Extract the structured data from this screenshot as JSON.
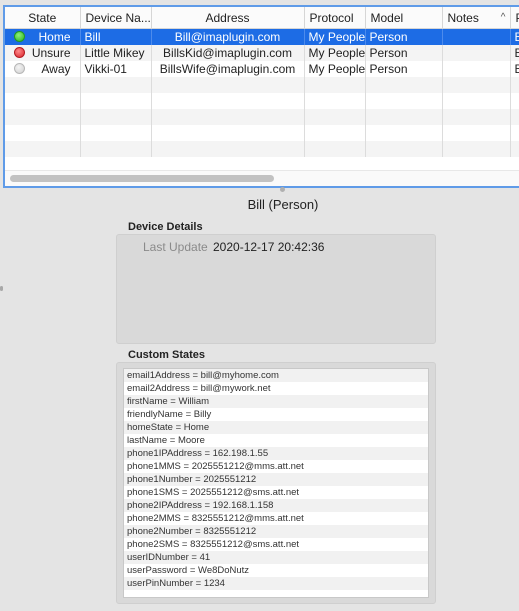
{
  "table": {
    "columns": {
      "state": "State",
      "device_name": "Device Na...",
      "address": "Address",
      "protocol": "Protocol",
      "model": "Model",
      "notes": "Notes",
      "extra": "P"
    },
    "rows": [
      {
        "status_color": "green",
        "state": "Home",
        "device_name": "Bill",
        "address": "Bill@imaplugin.com",
        "protocol": "My People",
        "model": "Person",
        "notes": "",
        "extra": "B"
      },
      {
        "status_color": "red",
        "state": "Unsure",
        "device_name": "Little Mikey",
        "address": "BillsKid@imaplugin.com",
        "protocol": "My People",
        "model": "Person",
        "notes": "",
        "extra": "B"
      },
      {
        "status_color": "gray",
        "state": "Away",
        "device_name": "Vikki-01",
        "address": "BillsWife@imaplugin.com",
        "protocol": "My People",
        "model": "Person",
        "notes": "",
        "extra": "B"
      }
    ],
    "empty_row_count": 5,
    "sort_icon": "chevron-up-icon"
  },
  "device_title": "Bill (Person)",
  "device_details": {
    "label": "Device Details",
    "last_update_label": "Last Update",
    "last_update_value": "2020-12-17 20:42:36"
  },
  "custom_states": {
    "label": "Custom States",
    "items": [
      "email1Address = bill@myhome.com",
      "email2Address = bill@mywork.net",
      "firstName = William",
      "friendlyName = Billy",
      "homeState = Home",
      "lastName = Moore",
      "phone1IPAddress = 162.198.1.55",
      "phone1MMS = 2025551212@mms.att.net",
      "phone1Number = 2025551212",
      "phone1SMS = 2025551212@sms.att.net",
      "phone2IPAddress = 192.168.1.158",
      "phone2MMS = 8325551212@mms.att.net",
      "phone2Number = 8325551212",
      "phone2SMS = 8325551212@sms.att.net",
      "userIDNumber = 41",
      "userPassword = We8DoNutz",
      "userPinNumber = 1234"
    ]
  },
  "colors": {
    "selection": "#1d6ce5",
    "focus_ring": "#5f9be8",
    "status_home": "#27b41f",
    "status_unsure": "#d8232a",
    "status_away": "#cfcfcf"
  }
}
